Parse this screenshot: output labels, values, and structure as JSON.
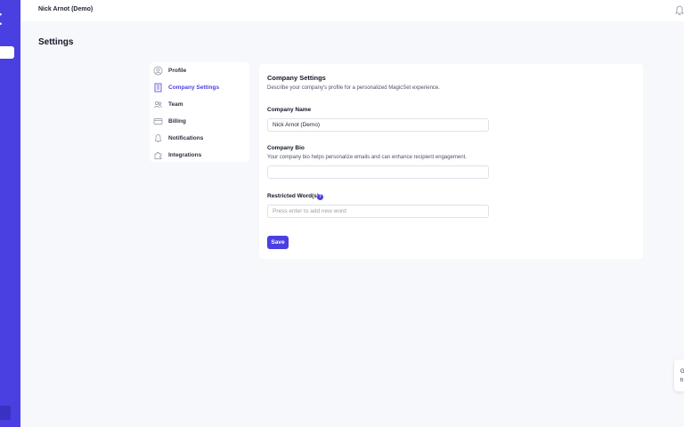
{
  "rail": {
    "logo_char": "t",
    "accent": "#4a3fe0"
  },
  "topbar": {
    "user_label": "Nick Arnot (Demo)",
    "bell_icon": "bell-icon"
  },
  "page": {
    "title": "Settings"
  },
  "nav": {
    "items": [
      {
        "label": "Profile",
        "icon": "user-circle-icon",
        "active": false
      },
      {
        "label": "Company Settings",
        "icon": "building-icon",
        "active": true
      },
      {
        "label": "Team",
        "icon": "team-icon",
        "active": false
      },
      {
        "label": "Billing",
        "icon": "credit-card-icon",
        "active": false
      },
      {
        "label": "Notifications",
        "icon": "bell-icon",
        "active": false
      },
      {
        "label": "Integrations",
        "icon": "puzzle-icon",
        "active": false
      }
    ]
  },
  "card": {
    "title": "Company Settings",
    "description": "Describe your company's profile for a personalized MagicSet experience.",
    "company_name": {
      "label": "Company Name",
      "value": "Nick Arnot (Demo)"
    },
    "company_bio": {
      "label": "Company Bio",
      "help": "Your company bio helps personalize emails and can enhance recipient engagement.",
      "value": ""
    },
    "restricted_words": {
      "label": "Restricted Word(s)",
      "help_icon": "?",
      "placeholder": "Press enter to add new word"
    },
    "save_label": "Save"
  },
  "side_widget": {
    "line1": "G",
    "line2": "h"
  }
}
